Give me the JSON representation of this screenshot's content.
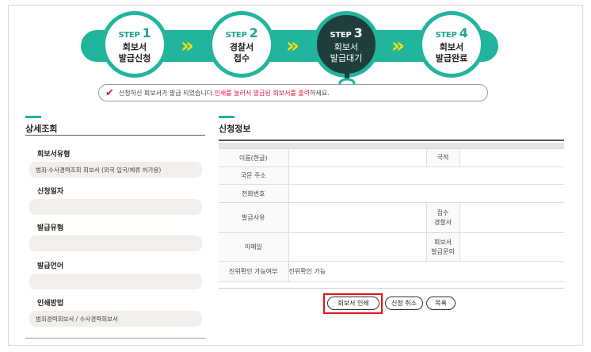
{
  "steps": [
    {
      "prefix": "STEP",
      "num": "1",
      "label": "회보서\n발급신청",
      "active": false
    },
    {
      "prefix": "STEP",
      "num": "2",
      "label": "경찰서\n접수",
      "active": false
    },
    {
      "prefix": "STEP",
      "num": "3",
      "label": "회보서\n발급대기",
      "active": true
    },
    {
      "prefix": "STEP",
      "num": "4",
      "label": "회보서\n발급완료",
      "active": false
    }
  ],
  "notice": {
    "text_before": "신청하신 회보서가 발급 되었습니다. ",
    "text_red": "인쇄를 눌러서 발급된 회보서를 출력",
    "text_after": "하세요."
  },
  "left_panel": {
    "title": "상세조회",
    "fields": [
      {
        "label": "회보서유형",
        "value": "범죄·수사경력조회 회보서 (외국 입국/체류 허가용)"
      },
      {
        "label": "신청일자",
        "value": ""
      },
      {
        "label": "발급유형",
        "value": ""
      },
      {
        "label": "발급언어",
        "value": ""
      },
      {
        "label": "인쇄방법",
        "value": "범죄경력회보서 / 수사경력회보서"
      }
    ]
  },
  "right_panel": {
    "title": "신청정보",
    "rows": {
      "name_label": "이름(한글)",
      "nationality_label": "국적",
      "address_label": "국문 주소",
      "phone_label": "전화번호",
      "reason_label": "발급사유",
      "station_label_1": "접수",
      "station_label_2": "경찰서",
      "email_label": "이메일",
      "doc_label_1": "회보서",
      "doc_label_2": "발급문의",
      "verify_label": "진위확인 가능여부",
      "verify_value": "진위확인 가능"
    }
  },
  "buttons": {
    "print": "회보서 인쇄",
    "cancel": "신청 취소",
    "list": "목록"
  },
  "colors": {
    "accent": "#20b59c",
    "active_step": "#1e3d3b",
    "chevron": "#ffe100",
    "highlight": "#e0151b",
    "notice_red": "#e5173f"
  }
}
